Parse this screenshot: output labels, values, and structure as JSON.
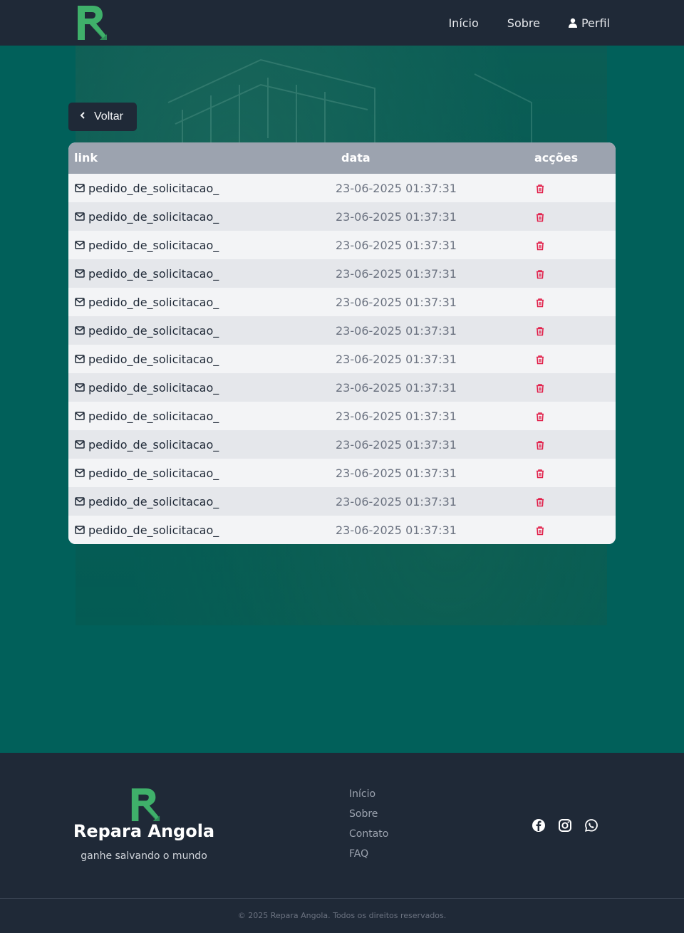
{
  "nav": {
    "links": [
      {
        "label": "Início"
      },
      {
        "label": "Sobre"
      },
      {
        "label": "Perfil"
      }
    ]
  },
  "back_button": {
    "label": "Voltar"
  },
  "table": {
    "headers": {
      "link": "link",
      "data": "data",
      "acoes": "acções"
    },
    "rows": [
      {
        "link": "pedido_de_solicitacao_",
        "data": "23-06-2025 01:37:31"
      },
      {
        "link": "pedido_de_solicitacao_",
        "data": "23-06-2025 01:37:31"
      },
      {
        "link": "pedido_de_solicitacao_",
        "data": "23-06-2025 01:37:31"
      },
      {
        "link": "pedido_de_solicitacao_",
        "data": "23-06-2025 01:37:31"
      },
      {
        "link": "pedido_de_solicitacao_",
        "data": "23-06-2025 01:37:31"
      },
      {
        "link": "pedido_de_solicitacao_",
        "data": "23-06-2025 01:37:31"
      },
      {
        "link": "pedido_de_solicitacao_",
        "data": "23-06-2025 01:37:31"
      },
      {
        "link": "pedido_de_solicitacao_",
        "data": "23-06-2025 01:37:31"
      },
      {
        "link": "pedido_de_solicitacao_",
        "data": "23-06-2025 01:37:31"
      },
      {
        "link": "pedido_de_solicitacao_",
        "data": "23-06-2025 01:37:31"
      },
      {
        "link": "pedido_de_solicitacao_",
        "data": "23-06-2025 01:37:31"
      },
      {
        "link": "pedido_de_solicitacao_",
        "data": "23-06-2025 01:37:31"
      },
      {
        "link": "pedido_de_solicitacao_",
        "data": "23-06-2025 01:37:31"
      }
    ],
    "row_icon": "mail-icon",
    "action_icon": "trash-icon"
  },
  "footer": {
    "brand": "Repara Angola",
    "tagline": "ganhe salvando o mundo",
    "links": [
      {
        "label": "Início"
      },
      {
        "label": "Sobre"
      },
      {
        "label": "Contato"
      },
      {
        "label": "FAQ"
      }
    ],
    "social": [
      "facebook-icon",
      "instagram-icon",
      "whatsapp-icon"
    ],
    "copyright": "© 2025 Repara Angola. Todos os direitos reservados."
  },
  "colors": {
    "navbar": "#1f2937",
    "page_bg": "#01605a",
    "brand_green": "#3fb06a",
    "delete_red": "#e11d48",
    "table_header": "#9ca3af"
  }
}
